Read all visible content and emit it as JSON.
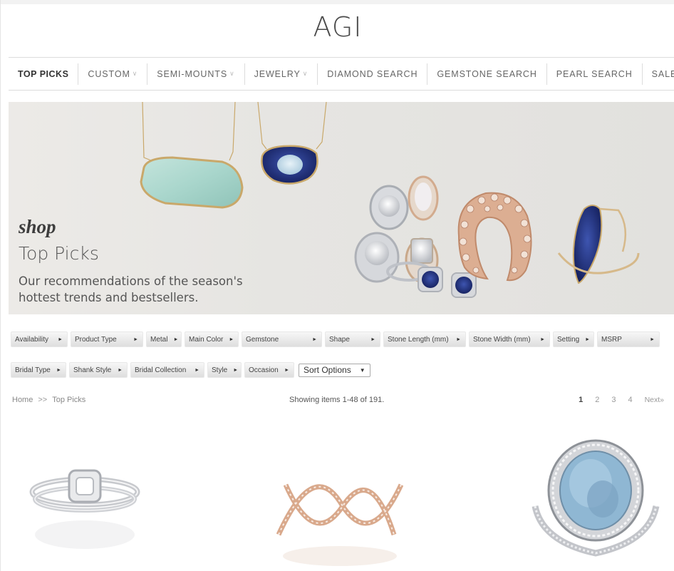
{
  "site": {
    "logo": "AGI"
  },
  "nav": {
    "items": [
      {
        "label": "TOP PICKS",
        "caret": false,
        "active": true
      },
      {
        "label": "CUSTOM",
        "caret": true
      },
      {
        "label": "SEMI-MOUNTS",
        "caret": true
      },
      {
        "label": "JEWELRY",
        "caret": true
      },
      {
        "label": "DIAMOND SEARCH",
        "caret": false
      },
      {
        "label": "GEMSTONE SEARCH",
        "caret": false
      },
      {
        "label": "PEARL SEARCH",
        "caret": false
      },
      {
        "label": "SALE",
        "caret": true
      }
    ],
    "caret_glyph": "∨"
  },
  "hero": {
    "shop": "shop",
    "title": "Top Picks",
    "subtitle": "Our recommendations of the season's hottest trends and bestsellers."
  },
  "filters": {
    "row1": [
      "Availability",
      "Product Type",
      "Metal",
      "Main Color",
      "Gemstone",
      "Shape",
      "Stone Length (mm)",
      "Stone Width (mm)",
      "Setting",
      "MSRP"
    ],
    "row2": [
      "Bridal Type",
      "Shank Style",
      "Bridal Collection",
      "Style",
      "Occasion"
    ],
    "sort_label": "Sort Options"
  },
  "listing": {
    "breadcrumb_home": "Home",
    "breadcrumb_sep": ">>",
    "breadcrumb_current": "Top Picks",
    "count_text": "Showing items 1-48 of 191.",
    "pages": [
      "1",
      "2",
      "3",
      "4"
    ],
    "next_label": "Next»"
  },
  "colors": {
    "accent_gold": "#c9a86a",
    "rose_gold": "#d9a98c",
    "sapphire": "#1f2f7a",
    "aqua_chalcedony": "#a9d6cc",
    "aquamarine": "#8fb7d3"
  }
}
